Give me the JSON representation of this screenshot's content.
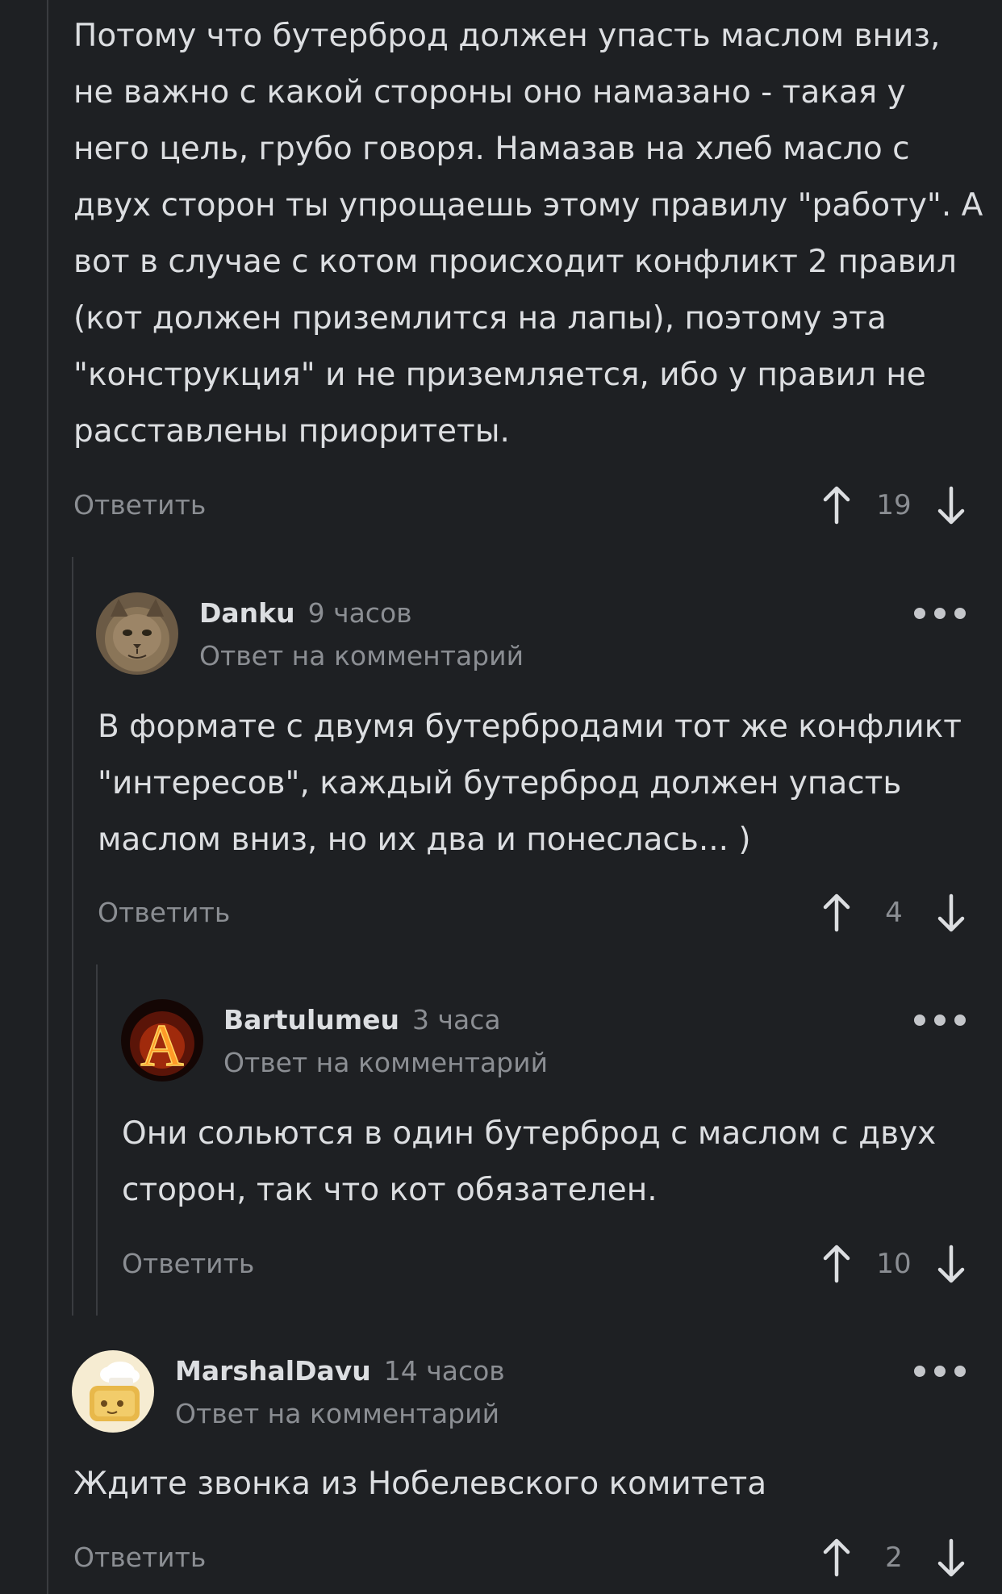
{
  "colors": {
    "background": "#1e2023",
    "text": "#dcdee1",
    "muted": "#8b8e93",
    "thread": "#3a3c40"
  },
  "icons": {
    "upvote": "arrow-up-icon",
    "downvote": "arrow-down-icon",
    "more": "more-dots-icon"
  },
  "comments": [
    {
      "text_lines": [
        "Потому что бутерброд должен упасть маслом вниз,",
        "не важно с какой стороны оно намазано - такая у",
        "него цель, грубо говоря. Намазав на хлеб масло с",
        "двух сторон ты упрощаешь этому правилу \"работу\". А",
        "вот в случае с котом происходит конфликт 2 правил",
        "(кот должен приземлится на лапы), поэтому эта",
        "\"конструкция\" и не приземляется, ибо у правил не",
        "расставлены приоритеты."
      ],
      "reply_label": "Ответить",
      "score": "19"
    },
    {
      "author": "Danku",
      "time": "9 часов",
      "subtitle": "Ответ на комментарий",
      "avatar": "cat-photo-avatar",
      "text_lines": [
        "В формате с двумя бутербродами тот же конфликт",
        "\"интересов\", каждый бутерброд должен упасть",
        "маслом вниз, но их два и понеслась... )"
      ],
      "reply_label": "Ответить",
      "score": "4"
    },
    {
      "author": "Bartulumeu",
      "time": "3 часа",
      "subtitle": "Ответ на комментарий",
      "avatar": "fire-letter-a-avatar",
      "avatar_letter": "A",
      "text_lines": [
        "Они сольются в один бутерброд с маслом с двух",
        "сторон, так что кот обязателен."
      ],
      "reply_label": "Ответить",
      "score": "10"
    },
    {
      "author": "MarshalDavu",
      "time": "14 часов",
      "subtitle": "Ответ на комментарий",
      "avatar": "toast-chef-avatar",
      "text_lines": [
        "Ждите звонка из Нобелевского комитета"
      ],
      "reply_label": "Ответить",
      "score": "2"
    }
  ]
}
